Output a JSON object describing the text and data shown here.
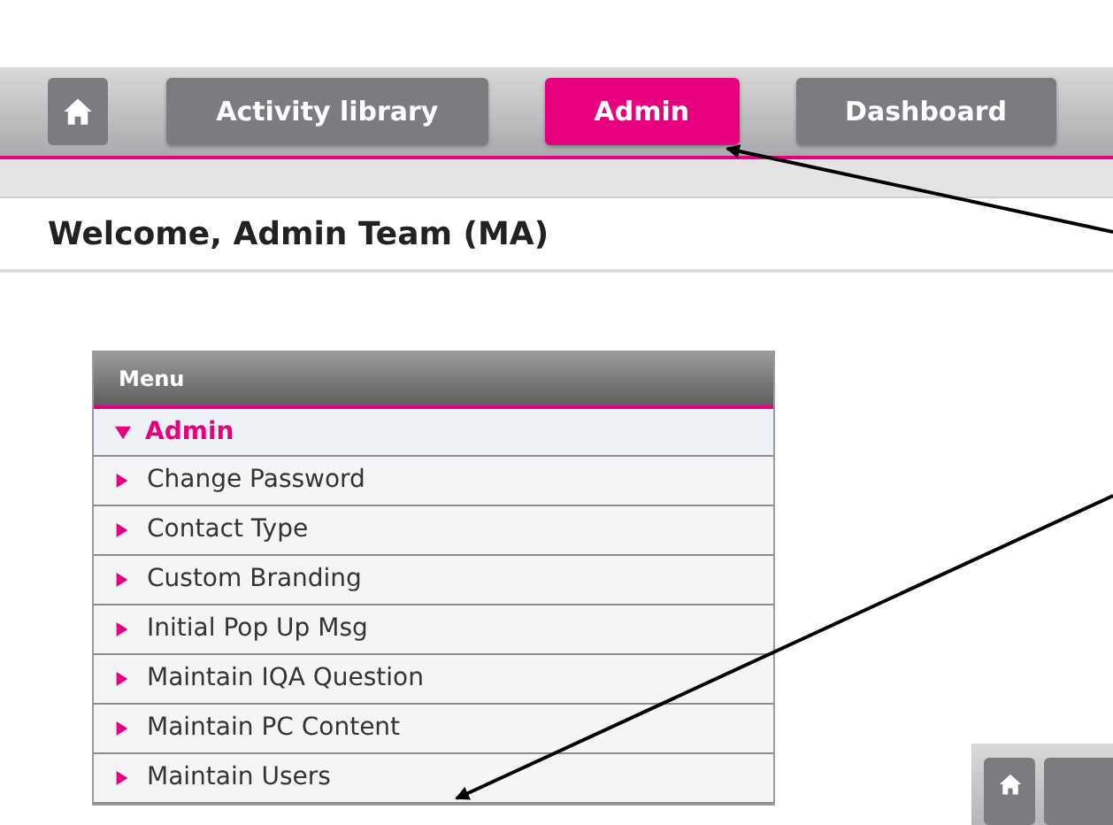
{
  "nav": {
    "tabs": [
      {
        "kind": "home",
        "selected": false
      },
      {
        "kind": "text",
        "label": "Activity library",
        "selected": false
      },
      {
        "kind": "text",
        "label": "Admin",
        "selected": true
      },
      {
        "kind": "text",
        "label": "Dashboard",
        "selected": false
      }
    ]
  },
  "welcome": "Welcome, Admin Team (MA)",
  "menu": {
    "title": "Menu",
    "groups": [
      {
        "label": "Admin",
        "expanded": true,
        "children": [
          {
            "label": "Change Password"
          },
          {
            "label": "Contact Type"
          },
          {
            "label": "Custom Branding"
          },
          {
            "label": "Initial Pop Up Msg"
          },
          {
            "label": "Maintain IQA Question"
          },
          {
            "label": "Maintain PC Content"
          },
          {
            "label": "Maintain Users"
          }
        ]
      }
    ]
  }
}
